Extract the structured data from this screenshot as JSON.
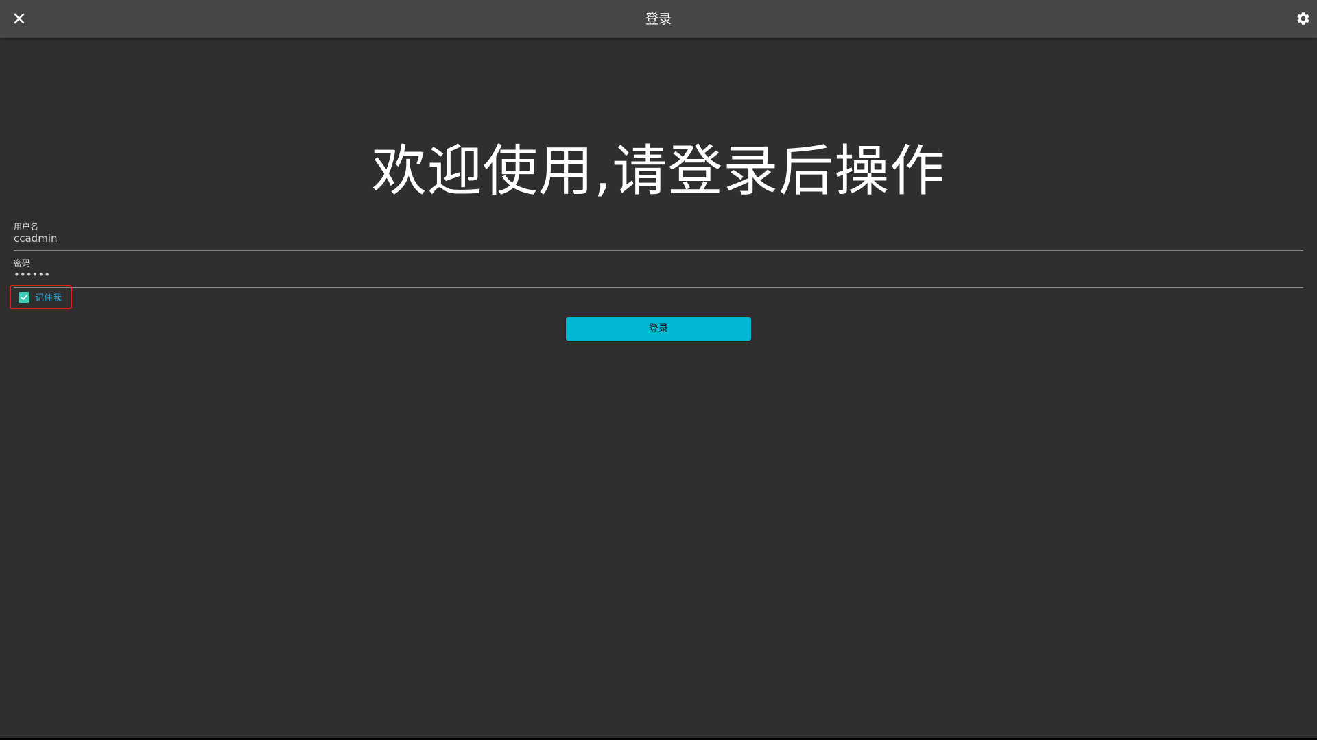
{
  "window": {
    "title": "登录",
    "close_icon": "close-icon",
    "settings_icon": "gear-icon"
  },
  "welcome_text": "欢迎使用,请登录后操作",
  "form": {
    "username": {
      "label": "用户名",
      "value": "ccadmin"
    },
    "password": {
      "label": "密码",
      "value": "••••••"
    },
    "remember": {
      "label": "记住我",
      "checked": true
    },
    "submit_label": "登录"
  },
  "colors": {
    "titlebar": "#464646",
    "background": "#2f2f2f",
    "button": "#00b8d4",
    "checkbox": "#3ec9b6",
    "link": "#2aa9e0",
    "highlight": "#e02020"
  }
}
